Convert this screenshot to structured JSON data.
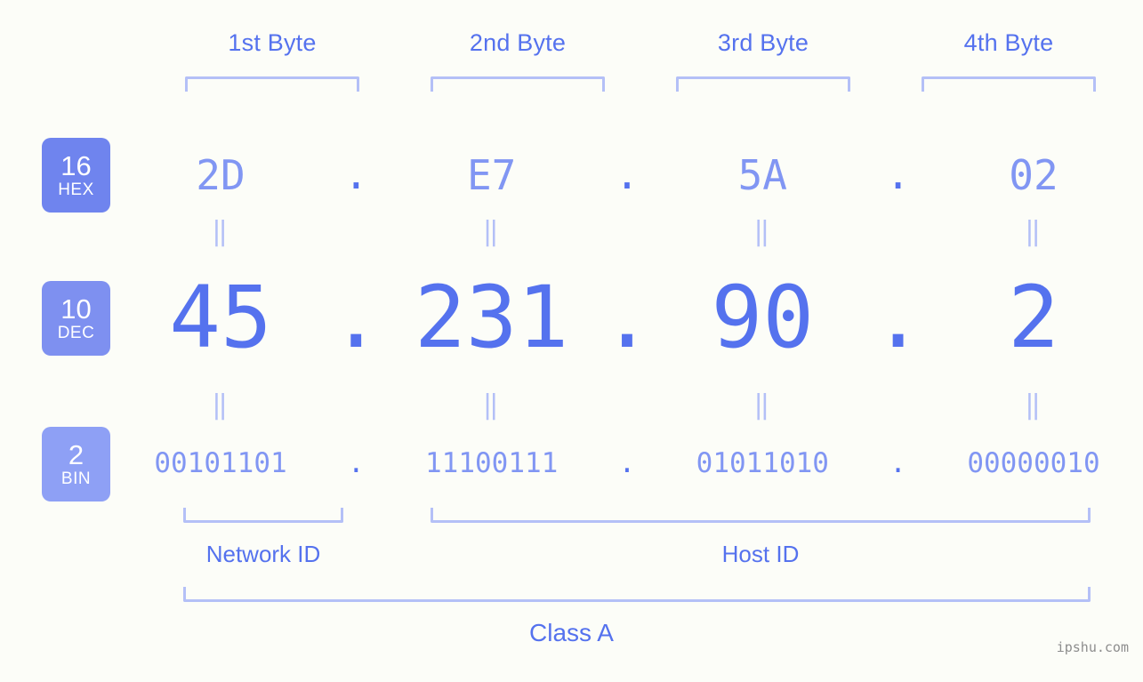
{
  "colors": {
    "background": "#fcfdf8",
    "accent_strong": "#5572ee",
    "accent_light": "#8196f3",
    "bracket": "#b4c0f7",
    "badge_hex": "#6f84ee",
    "badge_dec": "#7e90f0",
    "badge_bin": "#8ea0f5",
    "watermark": "#8d8d8d"
  },
  "byte_headers": [
    {
      "label": "1st Byte"
    },
    {
      "label": "2nd Byte"
    },
    {
      "label": "3rd Byte"
    },
    {
      "label": "4th Byte"
    }
  ],
  "radix_badges": [
    {
      "number": "16",
      "name": "HEX"
    },
    {
      "number": "10",
      "name": "DEC"
    },
    {
      "number": "2",
      "name": "BIN"
    }
  ],
  "rows": {
    "hex": {
      "values": [
        "2D",
        "E7",
        "5A",
        "02"
      ],
      "separator": "."
    },
    "dec": {
      "values": [
        "45",
        "231",
        "90",
        "2"
      ],
      "separator": "."
    },
    "bin": {
      "values": [
        "00101101",
        "11100111",
        "01011010",
        "00000010"
      ],
      "separator": "."
    }
  },
  "equals_connector": "‖",
  "id_sections": [
    {
      "label": "Network ID"
    },
    {
      "label": "Host ID"
    }
  ],
  "class_label": "Class A",
  "watermark": "ipshu.com"
}
